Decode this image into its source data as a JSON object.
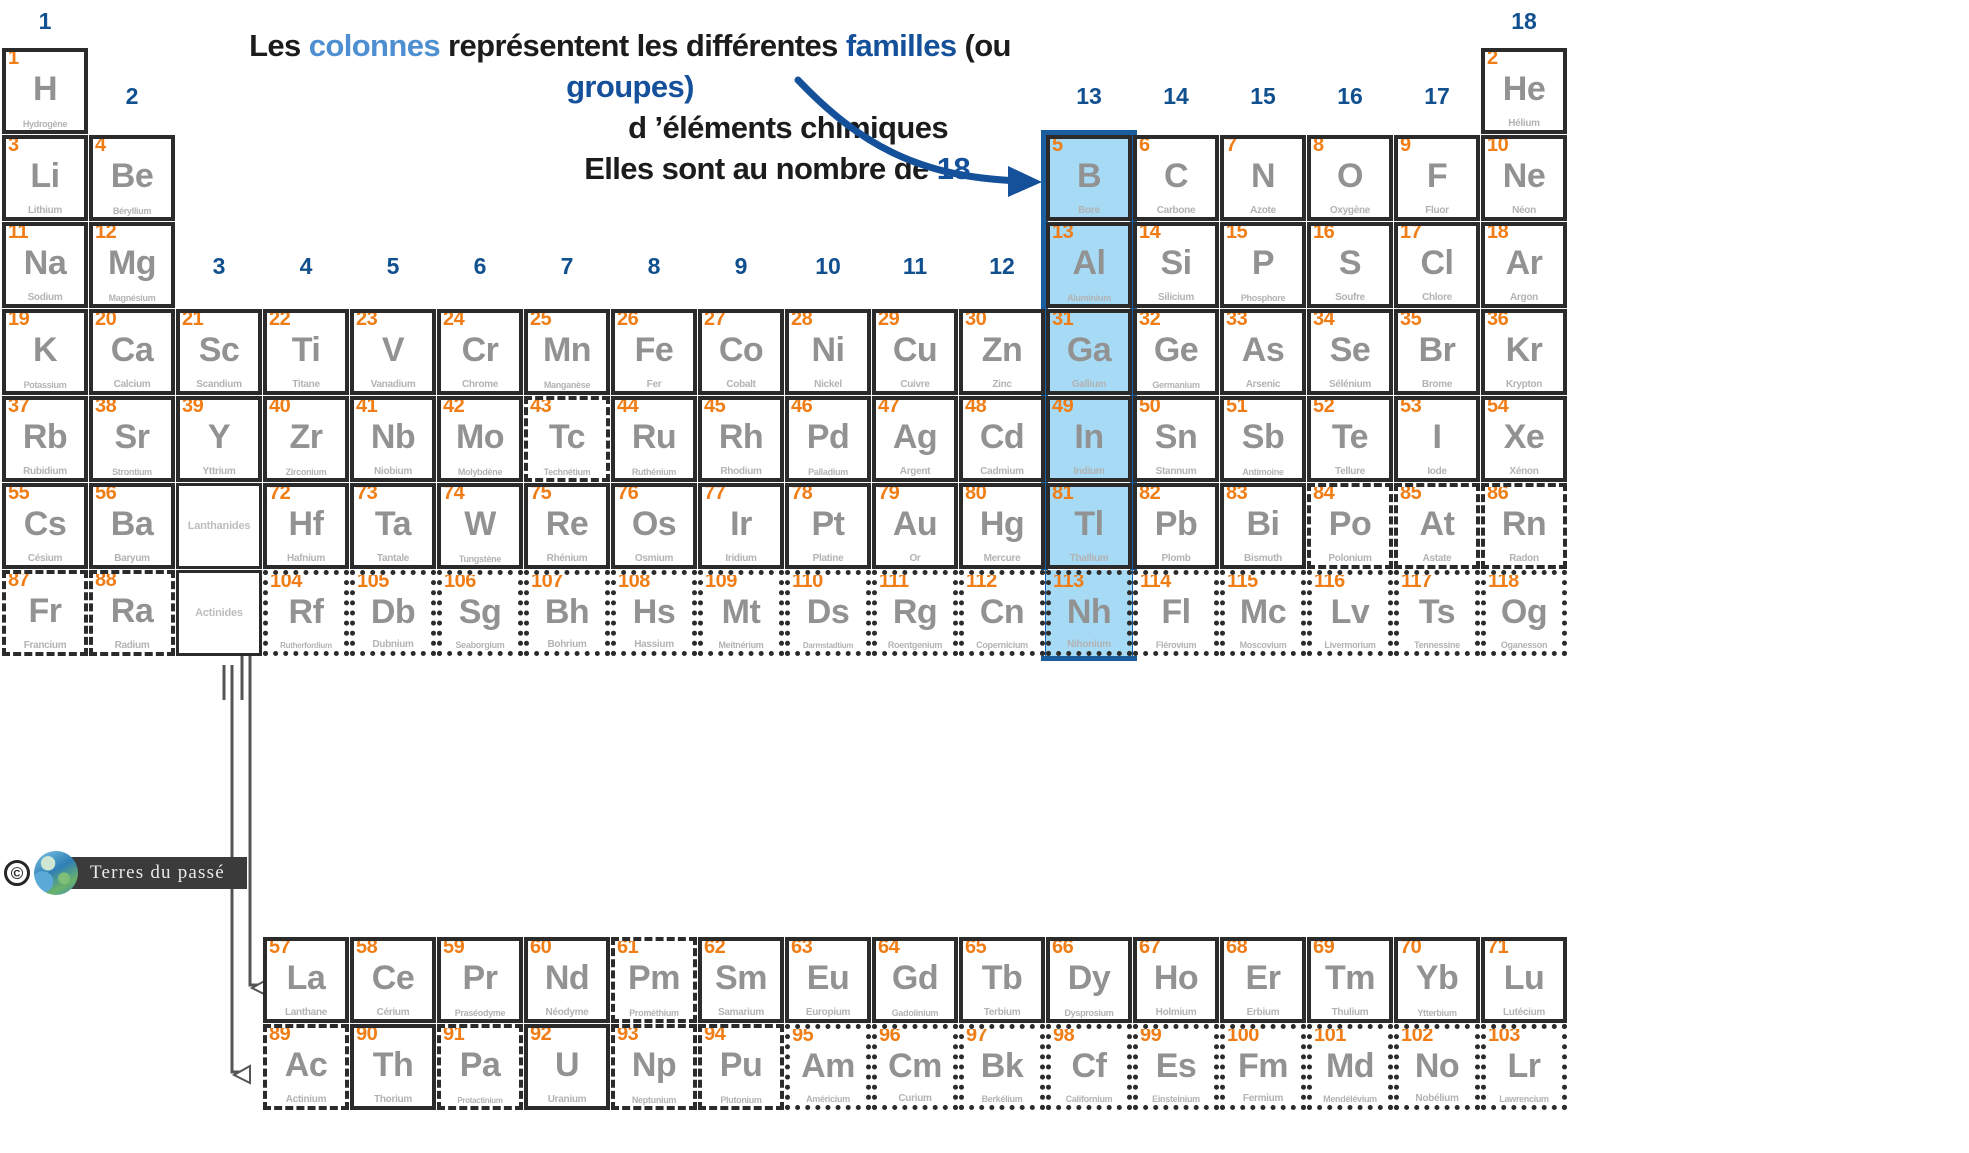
{
  "annotation": {
    "line1_a": "Les ",
    "line1_b": "colonnes",
    "line1_c": " représentent les  différentes ",
    "line1_d": "familles",
    "line1_e": " (ou ",
    "line1_f": "groupes)",
    "line2": "d ’éléments chimiques",
    "line3_a": "Elles sont au nombre de ",
    "line3_b": "18"
  },
  "colors": {
    "atomic_number": "#F07D15",
    "symbol": "#929292",
    "element_name": "#b3b3b3",
    "group_number": "#11508F",
    "highlight_fill": "#A6DAF5",
    "highlight_border": "#1A5EA0",
    "annotation_light_blue": "#4E8FD1",
    "annotation_dark_blue": "#14519A",
    "cell_border": "#2b2b2b"
  },
  "group_numbers": [
    "1",
    "2",
    "3",
    "4",
    "5",
    "6",
    "7",
    "8",
    "9",
    "10",
    "11",
    "12",
    "13",
    "14",
    "15",
    "16",
    "17",
    "18"
  ],
  "highlighted_group": "13",
  "placeholders": {
    "lanthanides": "Lanthanides",
    "actinides": "Actinides"
  },
  "watermark": {
    "copyright": "©",
    "text": "Terres du passé"
  },
  "elements": [
    {
      "z": "1",
      "sym": "H",
      "name": "Hydrogène",
      "col": 1,
      "row": 1,
      "border": "solid"
    },
    {
      "z": "2",
      "sym": "He",
      "name": "Hélium",
      "col": 18,
      "row": 1,
      "border": "solid"
    },
    {
      "z": "3",
      "sym": "Li",
      "name": "Lithium",
      "col": 1,
      "row": 2,
      "border": "solid"
    },
    {
      "z": "4",
      "sym": "Be",
      "name": "Béryllium",
      "col": 2,
      "row": 2,
      "border": "solid"
    },
    {
      "z": "5",
      "sym": "B",
      "name": "Bore",
      "col": 13,
      "row": 2,
      "border": "solid",
      "hl": true
    },
    {
      "z": "6",
      "sym": "C",
      "name": "Carbone",
      "col": 14,
      "row": 2,
      "border": "solid"
    },
    {
      "z": "7",
      "sym": "N",
      "name": "Azote",
      "col": 15,
      "row": 2,
      "border": "solid"
    },
    {
      "z": "8",
      "sym": "O",
      "name": "Oxygène",
      "col": 16,
      "row": 2,
      "border": "solid"
    },
    {
      "z": "9",
      "sym": "F",
      "name": "Fluor",
      "col": 17,
      "row": 2,
      "border": "solid"
    },
    {
      "z": "10",
      "sym": "Ne",
      "name": "Néon",
      "col": 18,
      "row": 2,
      "border": "solid"
    },
    {
      "z": "11",
      "sym": "Na",
      "name": "Sodium",
      "col": 1,
      "row": 3,
      "border": "solid"
    },
    {
      "z": "12",
      "sym": "Mg",
      "name": "Magnésium",
      "col": 2,
      "row": 3,
      "border": "solid"
    },
    {
      "z": "13",
      "sym": "Al",
      "name": "Aluminium",
      "col": 13,
      "row": 3,
      "border": "solid",
      "hl": true
    },
    {
      "z": "14",
      "sym": "Si",
      "name": "Silicium",
      "col": 14,
      "row": 3,
      "border": "solid"
    },
    {
      "z": "15",
      "sym": "P",
      "name": "Phosphore",
      "col": 15,
      "row": 3,
      "border": "solid"
    },
    {
      "z": "16",
      "sym": "S",
      "name": "Soufre",
      "col": 16,
      "row": 3,
      "border": "solid"
    },
    {
      "z": "17",
      "sym": "Cl",
      "name": "Chlore",
      "col": 17,
      "row": 3,
      "border": "solid"
    },
    {
      "z": "18",
      "sym": "Ar",
      "name": "Argon",
      "col": 18,
      "row": 3,
      "border": "solid"
    },
    {
      "z": "19",
      "sym": "K",
      "name": "Potassium",
      "col": 1,
      "row": 4,
      "border": "solid"
    },
    {
      "z": "20",
      "sym": "Ca",
      "name": "Calcium",
      "col": 2,
      "row": 4,
      "border": "solid"
    },
    {
      "z": "21",
      "sym": "Sc",
      "name": "Scandium",
      "col": 3,
      "row": 4,
      "border": "solid"
    },
    {
      "z": "22",
      "sym": "Ti",
      "name": "Titane",
      "col": 4,
      "row": 4,
      "border": "solid"
    },
    {
      "z": "23",
      "sym": "V",
      "name": "Vanadium",
      "col": 5,
      "row": 4,
      "border": "solid"
    },
    {
      "z": "24",
      "sym": "Cr",
      "name": "Chrome",
      "col": 6,
      "row": 4,
      "border": "solid"
    },
    {
      "z": "25",
      "sym": "Mn",
      "name": "Manganèse",
      "col": 7,
      "row": 4,
      "border": "solid"
    },
    {
      "z": "26",
      "sym": "Fe",
      "name": "Fer",
      "col": 8,
      "row": 4,
      "border": "solid"
    },
    {
      "z": "27",
      "sym": "Co",
      "name": "Cobalt",
      "col": 9,
      "row": 4,
      "border": "solid"
    },
    {
      "z": "28",
      "sym": "Ni",
      "name": "Nickel",
      "col": 10,
      "row": 4,
      "border": "solid"
    },
    {
      "z": "29",
      "sym": "Cu",
      "name": "Cuivre",
      "col": 11,
      "row": 4,
      "border": "solid"
    },
    {
      "z": "30",
      "sym": "Zn",
      "name": "Zinc",
      "col": 12,
      "row": 4,
      "border": "solid"
    },
    {
      "z": "31",
      "sym": "Ga",
      "name": "Gallium",
      "col": 13,
      "row": 4,
      "border": "solid",
      "hl": true
    },
    {
      "z": "32",
      "sym": "Ge",
      "name": "Germanium",
      "col": 14,
      "row": 4,
      "border": "solid"
    },
    {
      "z": "33",
      "sym": "As",
      "name": "Arsenic",
      "col": 15,
      "row": 4,
      "border": "solid"
    },
    {
      "z": "34",
      "sym": "Se",
      "name": "Sélénium",
      "col": 16,
      "row": 4,
      "border": "solid"
    },
    {
      "z": "35",
      "sym": "Br",
      "name": "Brome",
      "col": 17,
      "row": 4,
      "border": "solid"
    },
    {
      "z": "36",
      "sym": "Kr",
      "name": "Krypton",
      "col": 18,
      "row": 4,
      "border": "solid"
    },
    {
      "z": "37",
      "sym": "Rb",
      "name": "Rubidium",
      "col": 1,
      "row": 5,
      "border": "solid"
    },
    {
      "z": "38",
      "sym": "Sr",
      "name": "Strontium",
      "col": 2,
      "row": 5,
      "border": "solid"
    },
    {
      "z": "39",
      "sym": "Y",
      "name": "Yttrium",
      "col": 3,
      "row": 5,
      "border": "solid"
    },
    {
      "z": "40",
      "sym": "Zr",
      "name": "Zirconium",
      "col": 4,
      "row": 5,
      "border": "solid"
    },
    {
      "z": "41",
      "sym": "Nb",
      "name": "Niobium",
      "col": 5,
      "row": 5,
      "border": "solid"
    },
    {
      "z": "42",
      "sym": "Mo",
      "name": "Molybdène",
      "col": 6,
      "row": 5,
      "border": "solid"
    },
    {
      "z": "43",
      "sym": "Tc",
      "name": "Technétium",
      "col": 7,
      "row": 5,
      "border": "dashed"
    },
    {
      "z": "44",
      "sym": "Ru",
      "name": "Ruthénium",
      "col": 8,
      "row": 5,
      "border": "solid"
    },
    {
      "z": "45",
      "sym": "Rh",
      "name": "Rhodium",
      "col": 9,
      "row": 5,
      "border": "solid"
    },
    {
      "z": "46",
      "sym": "Pd",
      "name": "Palladium",
      "col": 10,
      "row": 5,
      "border": "solid"
    },
    {
      "z": "47",
      "sym": "Ag",
      "name": "Argent",
      "col": 11,
      "row": 5,
      "border": "solid"
    },
    {
      "z": "48",
      "sym": "Cd",
      "name": "Cadmium",
      "col": 12,
      "row": 5,
      "border": "solid"
    },
    {
      "z": "49",
      "sym": "In",
      "name": "Indium",
      "col": 13,
      "row": 5,
      "border": "solid",
      "hl": true
    },
    {
      "z": "50",
      "sym": "Sn",
      "name": "Stannum",
      "col": 14,
      "row": 5,
      "border": "solid"
    },
    {
      "z": "51",
      "sym": "Sb",
      "name": "Antimoine",
      "col": 15,
      "row": 5,
      "border": "solid"
    },
    {
      "z": "52",
      "sym": "Te",
      "name": "Tellure",
      "col": 16,
      "row": 5,
      "border": "solid"
    },
    {
      "z": "53",
      "sym": "I",
      "name": "Iode",
      "col": 17,
      "row": 5,
      "border": "solid"
    },
    {
      "z": "54",
      "sym": "Xe",
      "name": "Xénon",
      "col": 18,
      "row": 5,
      "border": "solid"
    },
    {
      "z": "55",
      "sym": "Cs",
      "name": "Césium",
      "col": 1,
      "row": 6,
      "border": "solid"
    },
    {
      "z": "56",
      "sym": "Ba",
      "name": "Baryum",
      "col": 2,
      "row": 6,
      "border": "solid"
    },
    {
      "z": "72",
      "sym": "Hf",
      "name": "Hafnium",
      "col": 4,
      "row": 6,
      "border": "solid"
    },
    {
      "z": "73",
      "sym": "Ta",
      "name": "Tantale",
      "col": 5,
      "row": 6,
      "border": "solid"
    },
    {
      "z": "74",
      "sym": "W",
      "name": "Tungstène",
      "col": 6,
      "row": 6,
      "border": "solid"
    },
    {
      "z": "75",
      "sym": "Re",
      "name": "Rhénium",
      "col": 7,
      "row": 6,
      "border": "solid"
    },
    {
      "z": "76",
      "sym": "Os",
      "name": "Osmium",
      "col": 8,
      "row": 6,
      "border": "solid"
    },
    {
      "z": "77",
      "sym": "Ir",
      "name": "Iridium",
      "col": 9,
      "row": 6,
      "border": "solid"
    },
    {
      "z": "78",
      "sym": "Pt",
      "name": "Platine",
      "col": 10,
      "row": 6,
      "border": "solid"
    },
    {
      "z": "79",
      "sym": "Au",
      "name": "Or",
      "col": 11,
      "row": 6,
      "border": "solid"
    },
    {
      "z": "80",
      "sym": "Hg",
      "name": "Mercure",
      "col": 12,
      "row": 6,
      "border": "solid"
    },
    {
      "z": "81",
      "sym": "Tl",
      "name": "Thallium",
      "col": 13,
      "row": 6,
      "border": "solid",
      "hl": true
    },
    {
      "z": "82",
      "sym": "Pb",
      "name": "Plomb",
      "col": 14,
      "row": 6,
      "border": "solid"
    },
    {
      "z": "83",
      "sym": "Bi",
      "name": "Bismuth",
      "col": 15,
      "row": 6,
      "border": "solid"
    },
    {
      "z": "84",
      "sym": "Po",
      "name": "Polonium",
      "col": 16,
      "row": 6,
      "border": "dashed"
    },
    {
      "z": "85",
      "sym": "At",
      "name": "Astate",
      "col": 17,
      "row": 6,
      "border": "dashed"
    },
    {
      "z": "86",
      "sym": "Rn",
      "name": "Radon",
      "col": 18,
      "row": 6,
      "border": "dashed"
    },
    {
      "z": "87",
      "sym": "Fr",
      "name": "Francium",
      "col": 1,
      "row": 7,
      "border": "dashed"
    },
    {
      "z": "88",
      "sym": "Ra",
      "name": "Radium",
      "col": 2,
      "row": 7,
      "border": "dashed"
    },
    {
      "z": "104",
      "sym": "Rf",
      "name": "Rutherfordium",
      "col": 4,
      "row": 7,
      "border": "dotted"
    },
    {
      "z": "105",
      "sym": "Db",
      "name": "Dubnium",
      "col": 5,
      "row": 7,
      "border": "dotted"
    },
    {
      "z": "106",
      "sym": "Sg",
      "name": "Seaborgium",
      "col": 6,
      "row": 7,
      "border": "dotted"
    },
    {
      "z": "107",
      "sym": "Bh",
      "name": "Bohrium",
      "col": 7,
      "row": 7,
      "border": "dotted"
    },
    {
      "z": "108",
      "sym": "Hs",
      "name": "Hassium",
      "col": 8,
      "row": 7,
      "border": "dotted"
    },
    {
      "z": "109",
      "sym": "Mt",
      "name": "Meitnérium",
      "col": 9,
      "row": 7,
      "border": "dotted"
    },
    {
      "z": "110",
      "sym": "Ds",
      "name": "Darmstadtium",
      "col": 10,
      "row": 7,
      "border": "dotted"
    },
    {
      "z": "111",
      "sym": "Rg",
      "name": "Roentgenium",
      "col": 11,
      "row": 7,
      "border": "dotted"
    },
    {
      "z": "112",
      "sym": "Cn",
      "name": "Copernicium",
      "col": 12,
      "row": 7,
      "border": "dotted"
    },
    {
      "z": "113",
      "sym": "Nh",
      "name": "Nihonium",
      "col": 13,
      "row": 7,
      "border": "dotted",
      "hl": true
    },
    {
      "z": "114",
      "sym": "Fl",
      "name": "Flérovium",
      "col": 14,
      "row": 7,
      "border": "dotted"
    },
    {
      "z": "115",
      "sym": "Mc",
      "name": "Moscovium",
      "col": 15,
      "row": 7,
      "border": "dotted"
    },
    {
      "z": "116",
      "sym": "Lv",
      "name": "Livermorium",
      "col": 16,
      "row": 7,
      "border": "dotted"
    },
    {
      "z": "117",
      "sym": "Ts",
      "name": "Tennessine",
      "col": 17,
      "row": 7,
      "border": "dotted"
    },
    {
      "z": "118",
      "sym": "Og",
      "name": "Oganesson",
      "col": 18,
      "row": 7,
      "border": "dotted"
    }
  ],
  "lanthanides": [
    {
      "z": "57",
      "sym": "La",
      "name": "Lanthane",
      "slot": 1,
      "border": "solid"
    },
    {
      "z": "58",
      "sym": "Ce",
      "name": "Cérium",
      "slot": 2,
      "border": "solid"
    },
    {
      "z": "59",
      "sym": "Pr",
      "name": "Praséodyme",
      "slot": 3,
      "border": "solid"
    },
    {
      "z": "60",
      "sym": "Nd",
      "name": "Néodyme",
      "slot": 4,
      "border": "solid"
    },
    {
      "z": "61",
      "sym": "Pm",
      "name": "Prométhium",
      "slot": 5,
      "border": "dashed"
    },
    {
      "z": "62",
      "sym": "Sm",
      "name": "Samarium",
      "slot": 6,
      "border": "solid"
    },
    {
      "z": "63",
      "sym": "Eu",
      "name": "Europium",
      "slot": 7,
      "border": "solid"
    },
    {
      "z": "64",
      "sym": "Gd",
      "name": "Gadolinium",
      "slot": 8,
      "border": "solid"
    },
    {
      "z": "65",
      "sym": "Tb",
      "name": "Terbium",
      "slot": 9,
      "border": "solid"
    },
    {
      "z": "66",
      "sym": "Dy",
      "name": "Dysprosium",
      "slot": 10,
      "border": "solid"
    },
    {
      "z": "67",
      "sym": "Ho",
      "name": "Holmium",
      "slot": 11,
      "border": "solid"
    },
    {
      "z": "68",
      "sym": "Er",
      "name": "Erbium",
      "slot": 12,
      "border": "solid"
    },
    {
      "z": "69",
      "sym": "Tm",
      "name": "Thulium",
      "slot": 13,
      "border": "solid"
    },
    {
      "z": "70",
      "sym": "Yb",
      "name": "Ytterbium",
      "slot": 14,
      "border": "solid"
    },
    {
      "z": "71",
      "sym": "Lu",
      "name": "Lutécium",
      "slot": 15,
      "border": "solid"
    }
  ],
  "actinides": [
    {
      "z": "89",
      "sym": "Ac",
      "name": "Actinium",
      "slot": 1,
      "border": "dashed"
    },
    {
      "z": "90",
      "sym": "Th",
      "name": "Thorium",
      "slot": 2,
      "border": "solid"
    },
    {
      "z": "91",
      "sym": "Pa",
      "name": "Protactinium",
      "slot": 3,
      "border": "dashed"
    },
    {
      "z": "92",
      "sym": "U",
      "name": "Uranium",
      "slot": 4,
      "border": "solid"
    },
    {
      "z": "93",
      "sym": "Np",
      "name": "Neptunium",
      "slot": 5,
      "border": "dashed"
    },
    {
      "z": "94",
      "sym": "Pu",
      "name": "Plutonium",
      "slot": 6,
      "border": "dashed"
    },
    {
      "z": "95",
      "sym": "Am",
      "name": "Américium",
      "slot": 7,
      "border": "dotted"
    },
    {
      "z": "96",
      "sym": "Cm",
      "name": "Curium",
      "slot": 8,
      "border": "dotted"
    },
    {
      "z": "97",
      "sym": "Bk",
      "name": "Berkélium",
      "slot": 9,
      "border": "dotted"
    },
    {
      "z": "98",
      "sym": "Cf",
      "name": "Californium",
      "slot": 10,
      "border": "dotted"
    },
    {
      "z": "99",
      "sym": "Es",
      "name": "Einsteinium",
      "slot": 11,
      "border": "dotted"
    },
    {
      "z": "100",
      "sym": "Fm",
      "name": "Fermium",
      "slot": 12,
      "border": "dotted"
    },
    {
      "z": "101",
      "sym": "Md",
      "name": "Mendélévium",
      "slot": 13,
      "border": "dotted"
    },
    {
      "z": "102",
      "sym": "No",
      "name": "Nobélium",
      "slot": 14,
      "border": "dotted"
    },
    {
      "z": "103",
      "sym": "Lr",
      "name": "Lawrencium",
      "slot": 15,
      "border": "dotted"
    }
  ]
}
